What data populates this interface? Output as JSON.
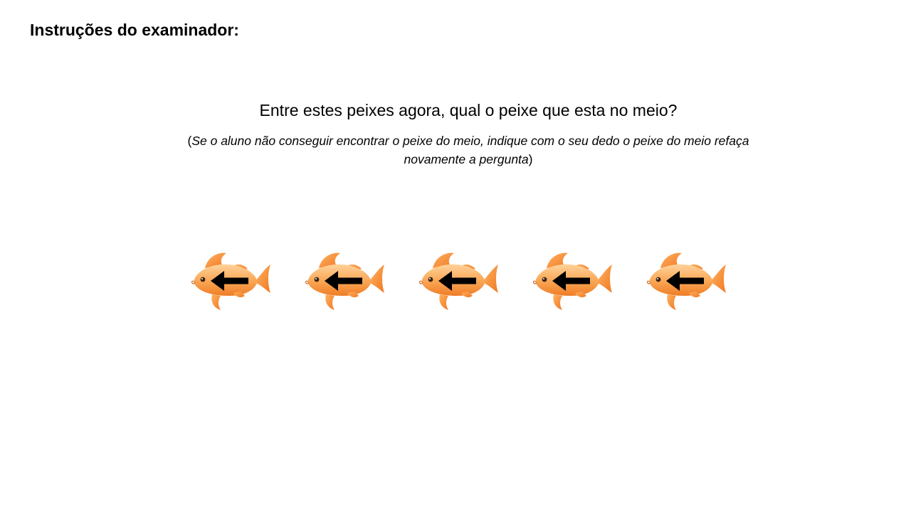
{
  "slide": {
    "heading": "Instruções do examinador:",
    "question": "Entre estes peixes agora, qual o peixe que esta no meio?",
    "note": {
      "open_paren": "(",
      "line1_italic": "Se o aluno não conseguir encontrar o peixe do meio, indique com o seu dedo o peixe do meio refaça",
      "line2_italic": "novamente a pergunta",
      "close_paren": ")"
    }
  },
  "fish_row": {
    "fish": [
      {
        "icon": "goldfish-icon",
        "arrow": "arrow-left-icon",
        "arrow_direction": "left"
      },
      {
        "icon": "goldfish-icon",
        "arrow": "arrow-left-icon",
        "arrow_direction": "left"
      },
      {
        "icon": "goldfish-icon",
        "arrow": "arrow-left-icon",
        "arrow_direction": "left"
      },
      {
        "icon": "goldfish-icon",
        "arrow": "arrow-left-icon",
        "arrow_direction": "left"
      },
      {
        "icon": "goldfish-icon",
        "arrow": "arrow-left-icon",
        "arrow_direction": "left"
      }
    ]
  },
  "colors": {
    "fish_body_light": "#ffc785",
    "fish_body_dark": "#f0822a",
    "fish_fin": "#f5923a",
    "arrow": "#000000",
    "background": "#ffffff"
  }
}
